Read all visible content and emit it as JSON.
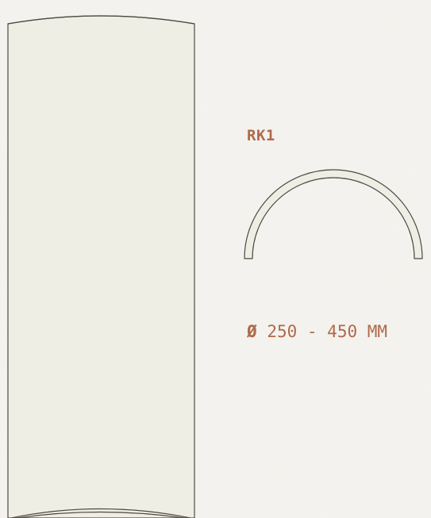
{
  "profile": {
    "code": "RK1",
    "diameter_symbol": "Ø",
    "diameter_range": "250 - 450 MM"
  },
  "colors": {
    "background": "#f4f3ef",
    "column_fill": "#efeee5",
    "outline": "#4d4a40",
    "accent_text": "#b06a4a"
  }
}
